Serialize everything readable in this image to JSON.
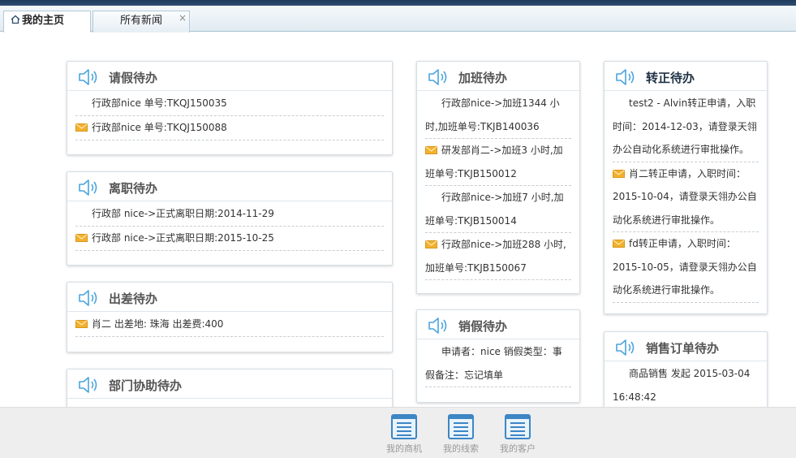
{
  "tabs": [
    {
      "label": "我的主页",
      "active": true
    },
    {
      "label": "所有新闻",
      "active": false,
      "close": "×"
    }
  ],
  "colors": {
    "accent": "#3b8fd6",
    "mail": "#f2b12e",
    "topbar": "#1e3a5c"
  },
  "panels": {
    "leave": {
      "title": "请假待办",
      "items": [
        {
          "text": "行政部nice 单号:TKQJ150035",
          "unread": false
        },
        {
          "text": "行政部nice 单号:TKQJ150088",
          "unread": true
        }
      ]
    },
    "resign": {
      "title": "离职待办",
      "items": [
        {
          "text": "行政部 nice->正式离职日期:2014-11-29",
          "unread": false
        },
        {
          "text": "行政部 nice->正式离职日期:2015-10-25",
          "unread": true
        }
      ]
    },
    "trip": {
      "title": "出差待办",
      "items": [
        {
          "text": "肖二 出差地: 珠海 出差费:400",
          "unread": true
        }
      ]
    },
    "dept": {
      "title": "部门协助待办",
      "items": []
    },
    "overtime": {
      "title": "加班待办",
      "items": [
        {
          "text": "行政部nice->加班1344 小时,加班单号:TKJB140036",
          "unread": false
        },
        {
          "text": "研发部肖二->加班3 小时,加班单号:TKJB150012",
          "unread": true
        },
        {
          "text": "行政部nice->加班7 小时,加班单号:TKJB150014",
          "unread": false
        },
        {
          "text": "行政部nice->加班288 小时,加班单号:TKJB150067",
          "unread": true
        }
      ]
    },
    "cancel_leave": {
      "title": "销假待办",
      "items": [
        {
          "text": "申请者：nice 销假类型：事假备注：忘记填单",
          "unread": false
        }
      ]
    },
    "regular": {
      "title": "转正待办",
      "items": [
        {
          "text": "test2 - Alvin转正申请，入职时间：2014-12-03，请登录天翎办公自动化系统进行审批操作。",
          "unread": false
        },
        {
          "text": "肖二转正申请，入职时间：2015-10-04，请登录天翎办公自动化系统进行审批操作。",
          "unread": true
        },
        {
          "text": "fd转正申请，入职时间：2015-10-05，请登录天翎办公自动化系统进行审批操作。",
          "unread": true
        }
      ]
    },
    "sales": {
      "title": "销售订单待办",
      "items": [
        {
          "text": "商品销售 发起 2015-03-04 16:48:42",
          "unread": false
        }
      ]
    }
  },
  "footer": {
    "buttons": [
      {
        "label": "我的商机",
        "icon": "list-icon"
      },
      {
        "label": "我的线索",
        "icon": "list-icon"
      },
      {
        "label": "我的客户",
        "icon": "list-icon"
      }
    ]
  }
}
